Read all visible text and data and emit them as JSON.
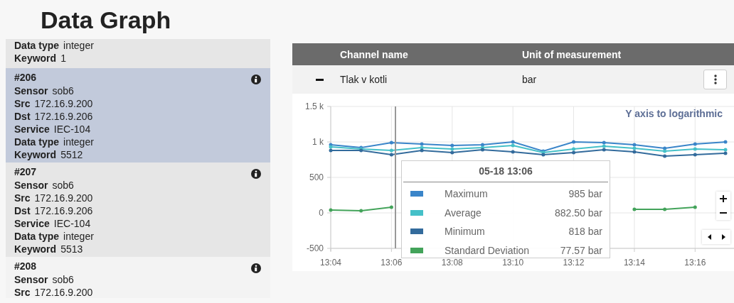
{
  "title": "Data Graph",
  "items": [
    {
      "selected": false,
      "fields": [
        {
          "label": "Data type",
          "value": "integer"
        },
        {
          "label": "Keyword",
          "value": "1"
        }
      ]
    },
    {
      "number": "#206",
      "selected": true,
      "fields": [
        {
          "label": "Sensor",
          "value": "sob6"
        },
        {
          "label": "Src",
          "value": "172.16.9.200"
        },
        {
          "label": "Dst",
          "value": "172.16.9.206"
        },
        {
          "label": "Service",
          "value": "IEC-104"
        },
        {
          "label": "Data type",
          "value": "integer"
        },
        {
          "label": "Keyword",
          "value": "5512"
        }
      ]
    },
    {
      "number": "#207",
      "selected": false,
      "fields": [
        {
          "label": "Sensor",
          "value": "sob6"
        },
        {
          "label": "Src",
          "value": "172.16.9.200"
        },
        {
          "label": "Dst",
          "value": "172.16.9.206"
        },
        {
          "label": "Service",
          "value": "IEC-104"
        },
        {
          "label": "Data type",
          "value": "integer"
        },
        {
          "label": "Keyword",
          "value": "5513"
        }
      ]
    },
    {
      "number": "#208",
      "selected": false,
      "fields": [
        {
          "label": "Sensor",
          "value": "sob6"
        },
        {
          "label": "Src",
          "value": "172.16.9.200"
        }
      ]
    }
  ],
  "table": {
    "columns": [
      "Channel name",
      "Unit of measurement"
    ],
    "rows": [
      {
        "expanded": true,
        "name": "Tlak v kotli",
        "unit": "bar"
      }
    ]
  },
  "chart": {
    "log_toggle": "Y axis to logarithmic",
    "tooltip": {
      "title": "05-18 13:06",
      "values": [
        "985 bar",
        "882.50 bar",
        "818 bar",
        "77.57 bar"
      ]
    },
    "chart_data": {
      "type": "line",
      "grid": true,
      "x": [
        "13:04",
        null,
        "13:06",
        null,
        "13:08",
        null,
        "13:10",
        null,
        "13:12",
        null,
        "13:14",
        null,
        "13:16",
        null
      ],
      "series": [
        {
          "name": "Maximum",
          "color": "#3a85c9",
          "values": [
            960,
            920,
            990,
            970,
            950,
            960,
            1000,
            870,
            1000,
            990,
            960,
            910,
            970,
            1000
          ]
        },
        {
          "name": "Average",
          "color": "#45c0c8",
          "values": [
            930,
            900,
            880,
            920,
            900,
            920,
            950,
            850,
            900,
            940,
            910,
            870,
            900,
            890
          ]
        },
        {
          "name": "Minimum",
          "color": "#336b9c",
          "values": [
            880,
            880,
            820,
            880,
            850,
            890,
            860,
            820,
            850,
            890,
            860,
            800,
            820,
            840
          ]
        },
        {
          "name": "Standard Deviation",
          "color": "#43a35a",
          "values": [
            40,
            30,
            80,
            null,
            null,
            null,
            null,
            null,
            null,
            null,
            50,
            50,
            80,
            null
          ]
        }
      ],
      "ylim": [
        -500,
        1500
      ],
      "yticks": [
        {
          "value": -500,
          "label": "-500"
        },
        {
          "value": 0,
          "label": "0"
        },
        {
          "value": 500,
          "label": "500"
        },
        {
          "value": 1000,
          "label": "1 k"
        },
        {
          "value": 1500,
          "label": "1.5 k"
        }
      ]
    }
  }
}
